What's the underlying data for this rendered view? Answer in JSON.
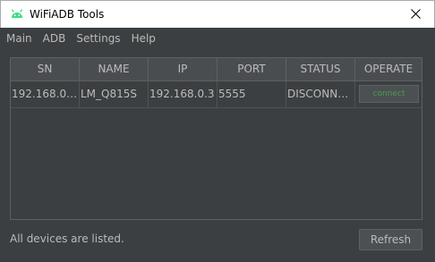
{
  "window": {
    "title": "WiFiADB Tools",
    "icon": "android-icon",
    "close_icon": "close-icon"
  },
  "menu": [
    {
      "label": "Main"
    },
    {
      "label": "ADB"
    },
    {
      "label": "Settings"
    },
    {
      "label": "Help"
    }
  ],
  "table": {
    "headers": [
      "SN",
      "NAME",
      "IP",
      "PORT",
      "STATUS",
      "OPERATE"
    ],
    "rows": [
      {
        "sn": "192.168.0.3...",
        "name": "LM_Q815S",
        "ip": "192.168.0.3",
        "port": "5555",
        "status": "DISCONNE...",
        "operate": "connect"
      }
    ]
  },
  "status_text": "All devices are listed.",
  "refresh_label": "Refresh",
  "colors": {
    "background": "#3c3f41",
    "header": "#4a4d50",
    "text": "#bbbbbb",
    "connect_text": "#499c54",
    "android_green": "#3ddc84"
  }
}
